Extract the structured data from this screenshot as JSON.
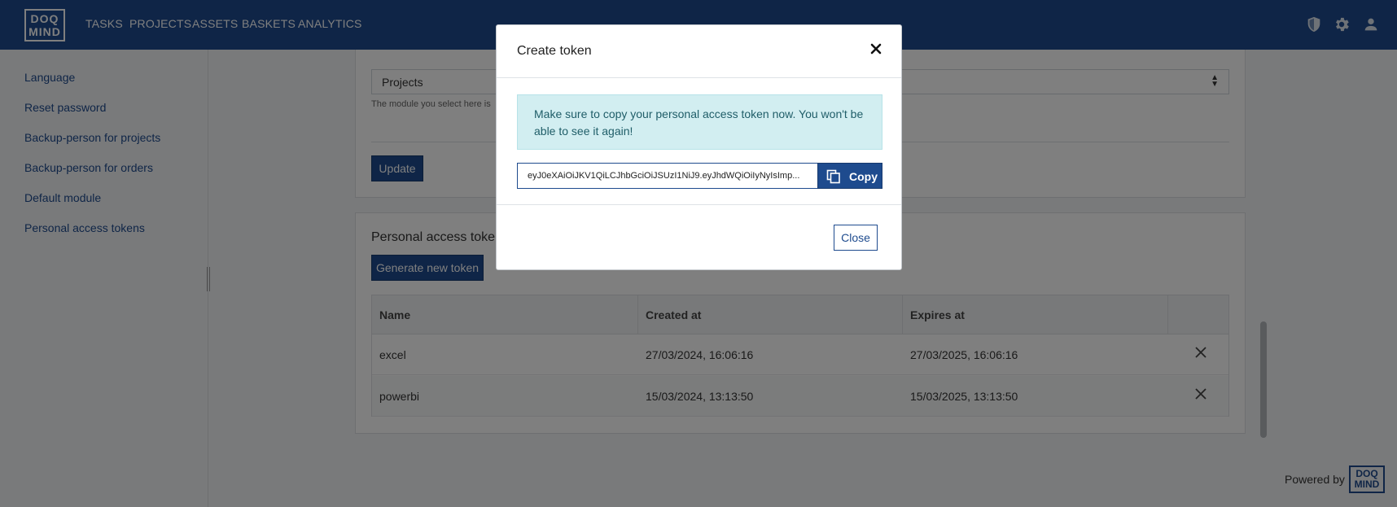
{
  "header": {
    "logo_text": "DOQ MIND",
    "nav": [
      "TASKS",
      "PROJECTS",
      "ASSETS",
      "BASKETS",
      "ANALYTICS"
    ],
    "icons": [
      "shield-icon",
      "gear-icon",
      "user-icon"
    ]
  },
  "sidebar": {
    "items": [
      {
        "label": "Language"
      },
      {
        "label": "Reset password"
      },
      {
        "label": "Backup-person for projects"
      },
      {
        "label": "Backup-person for orders"
      },
      {
        "label": "Default module"
      },
      {
        "label": "Personal access tokens"
      }
    ]
  },
  "default_module": {
    "select_value": "Projects",
    "help_text": "The module you select here is",
    "update_label": "Update"
  },
  "tokens": {
    "title": "Personal access tokens",
    "generate_label": "Generate new token",
    "columns": [
      "Name",
      "Created at",
      "Expires at"
    ],
    "rows": [
      {
        "name": "excel",
        "created": "27/03/2024, 16:06:16",
        "expires": "27/03/2025, 16:06:16"
      },
      {
        "name": "powerbi",
        "created": "15/03/2024, 13:13:50",
        "expires": "15/03/2025, 13:13:50"
      }
    ]
  },
  "footer": {
    "powered_by": "Powered by",
    "logo_text": "DOQ MIND"
  },
  "modal": {
    "title": "Create token",
    "alert": "Make sure to copy your personal access token now. You won't be able to see it again!",
    "token_value": "eyJ0eXAiOiJKV1QiLCJhbGciOiJSUzI1NiJ9.eyJhdWQiOiIyNyIsImp...",
    "copy_label": "Copy",
    "close_label": "Close"
  },
  "colors": {
    "brand": "#1e4b8e",
    "alert_bg": "#d2eef1",
    "alert_text": "#1f5d68"
  }
}
